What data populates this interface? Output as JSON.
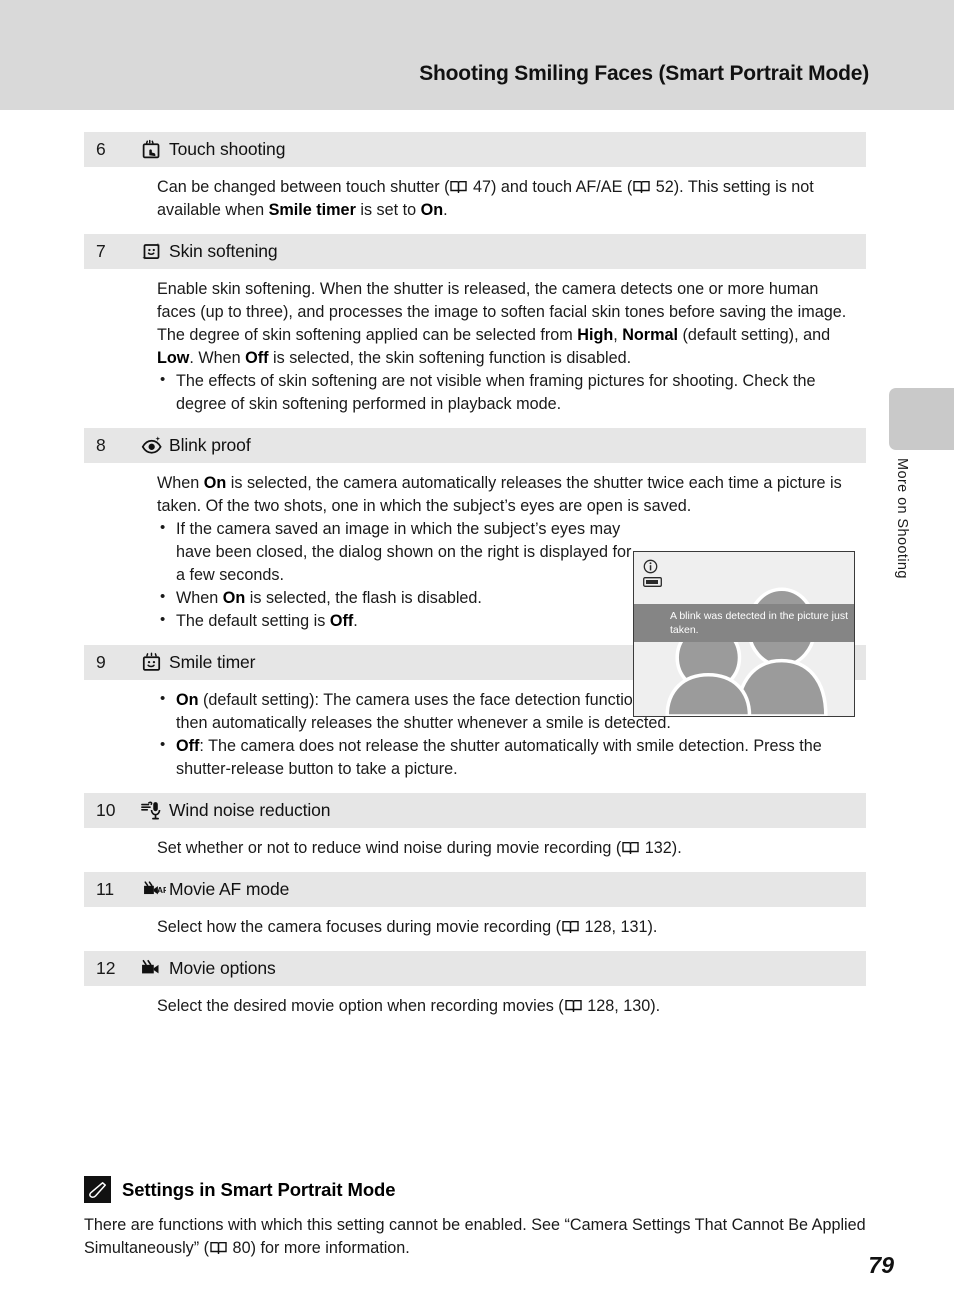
{
  "header": {
    "title": "Shooting Smiling Faces (Smart Portrait Mode)"
  },
  "side_tab": {
    "label": "More on Shooting"
  },
  "page_number": "79",
  "table": {
    "rows": [
      {
        "num": "6",
        "icon": "touch-shooting-icon",
        "title": "Touch shooting",
        "body_html": "Can be changed between touch shutter (<span class=\"book-ico\" data-name=\"manual-reference-icon\" data-interactable=\"false\"><svg width=\"17\" height=\"13\" viewBox=\"0 0 17 13\"><path d=\"M1 1.7h6.2c.6 0 1.1.5 1.3 1v8.6c-.3-.5-.7-.8-1.3-.8H1zM16 1.7H9.8c-.6 0-1.1.5-1.3 1v8.6c.3-.5.7-.8 1.3-.8H16z\" fill=\"none\" stroke=\"#111\" stroke-width=\"1.4\"/><path d=\"M8.5 2.6v8.8\" stroke=\"#111\" stroke-width=\"1.3\"/></svg></span> 47) and touch AF/AE (<span class=\"book-ico\" data-name=\"manual-reference-icon\" data-interactable=\"false\"><svg width=\"17\" height=\"13\" viewBox=\"0 0 17 13\"><path d=\"M1 1.7h6.2c.6 0 1.1.5 1.3 1v8.6c-.3-.5-.7-.8-1.3-.8H1zM16 1.7H9.8c-.6 0-1.1.5-1.3 1v8.6c.3-.5.7-.8 1.3-.8H16z\" fill=\"none\" stroke=\"#111\" stroke-width=\"1.4\"/><path d=\"M8.5 2.6v8.8\" stroke=\"#111\" stroke-width=\"1.3\"/></svg></span> 52). This setting is not available when <b>Smile timer</b> is set to <b>On</b>."
      },
      {
        "num": "7",
        "icon": "skin-softening-icon",
        "title": "Skin softening",
        "body_html": "Enable skin softening. When the shutter is released, the camera detects one or more human faces (up to three), and processes the image to soften facial skin tones before saving the image.<br>The degree of skin softening applied can be selected from <b>High</b>, <b>Normal</b> (default setting), and <b>Low</b>. When <b>Off</b> is selected, the skin softening function is disabled.<ul class=\"bullets\"><li data-name=\"list-item\" data-interactable=\"false\">The effects of skin softening are not visible when framing pictures for shooting. Check the degree of skin softening performed in playback mode.</li></ul>"
      },
      {
        "num": "8",
        "icon": "blink-proof-icon",
        "title": "Blink proof",
        "body_html": "When <b>On</b> is selected, the camera automatically releases the shutter twice each time a picture is taken. Of the two shots, one in which the subject&rsquo;s eyes are open is saved.<ul class=\"bullets\"><li data-name=\"list-item\" data-interactable=\"false\" style=\"max-width:460px\">If the camera saved an image in which the subject&rsquo;s eyes may have been closed, the dialog shown on the right is displayed for a few seconds.</li><li data-name=\"list-item\" data-interactable=\"false\">When <b>On</b> is selected, the flash is disabled.</li><li data-name=\"list-item\" data-interactable=\"false\">The default setting is <b>Off</b>.</li></ul>"
      },
      {
        "num": "9",
        "icon": "smile-timer-icon",
        "title": "Smile timer",
        "body_html": "<ul class=\"bullets\"><li data-name=\"list-item\" data-interactable=\"false\"><b>On</b> (default setting): The camera uses the face detection function to detect a human face, and then automatically releases the shutter whenever a smile is detected.</li><li data-name=\"list-item\" data-interactable=\"false\"><b>Off</b>: The camera does not release the shutter automatically with smile detection. Press the shutter-release button to take a picture.</li></ul>"
      },
      {
        "num": "10",
        "icon": "wind-noise-reduction-icon",
        "title": "Wind noise reduction",
        "body_html": "Set whether or not to reduce wind noise during movie recording (<span class=\"book-ico\" data-name=\"manual-reference-icon\" data-interactable=\"false\"><svg width=\"17\" height=\"13\" viewBox=\"0 0 17 13\"><path d=\"M1 1.7h6.2c.6 0 1.1.5 1.3 1v8.6c-.3-.5-.7-.8-1.3-.8H1zM16 1.7H9.8c-.6 0-1.1.5-1.3 1v8.6c.3-.5.7-.8 1.3-.8H16z\" fill=\"none\" stroke=\"#111\" stroke-width=\"1.4\"/><path d=\"M8.5 2.6v8.8\" stroke=\"#111\" stroke-width=\"1.3\"/></svg></span> 132)."
      },
      {
        "num": "11",
        "icon": "movie-af-mode-icon",
        "title": "Movie AF mode",
        "body_html": "Select how the camera focuses during movie recording (<span class=\"book-ico\" data-name=\"manual-reference-icon\" data-interactable=\"false\"><svg width=\"17\" height=\"13\" viewBox=\"0 0 17 13\"><path d=\"M1 1.7h6.2c.6 0 1.1.5 1.3 1v8.6c-.3-.5-.7-.8-1.3-.8H1zM16 1.7H9.8c-.6 0-1.1.5-1.3 1v8.6c.3-.5.7-.8 1.3-.8H16z\" fill=\"none\" stroke=\"#111\" stroke-width=\"1.4\"/><path d=\"M8.5 2.6v8.8\" stroke=\"#111\" stroke-width=\"1.3\"/></svg></span> 128, 131)."
      },
      {
        "num": "12",
        "icon": "movie-options-icon",
        "title": "Movie options",
        "body_html": "Select the desired movie option when recording movies (<span class=\"book-ico\" data-name=\"manual-reference-icon\" data-interactable=\"false\"><svg width=\"17\" height=\"13\" viewBox=\"0 0 17 13\"><path d=\"M1 1.7h6.2c.6 0 1.1.5 1.3 1v8.6c-.3-.5-.7-.8-1.3-.8H1zM16 1.7H9.8c-.6 0-1.1.5-1.3 1v8.6c.3-.5.7-.8 1.3-.8H16z\" fill=\"none\" stroke=\"#111\" stroke-width=\"1.4\"/><path d=\"M8.5 2.6v8.8\" stroke=\"#111\" stroke-width=\"1.3\"/></svg></span> 128, 130)."
      }
    ]
  },
  "camera_screen": {
    "message": "A blink was detected in the picture just taken.",
    "info_icon": "info-icon",
    "card_icon": "memory-card-icon",
    "banner_color": "#858585",
    "screen_bg": "#eeeeee",
    "silhouette_color": "#9b9b9b"
  },
  "note": {
    "badge_icon": "pencil-note-icon",
    "title": "Settings in Smart Portrait Mode",
    "body_html": "There are functions with which this setting cannot be enabled. See &ldquo;Camera Settings That Cannot Be Applied Simultaneously&rdquo; (<span class=\"book-ico\" data-name=\"manual-reference-icon\" data-interactable=\"false\"><svg width=\"17\" height=\"13\" viewBox=\"0 0 17 13\"><path d=\"M1 1.7h6.2c.6 0 1.1.5 1.3 1v8.6c-.3-.5-.7-.8-1.3-.8H1zM16 1.7H9.8c-.6 0-1.1.5-1.3 1v8.6c.3-.5.7-.8 1.3-.8H16z\" fill=\"none\" stroke=\"#111\" stroke-width=\"1.4\"/><path d=\"M8.5 2.6v8.8\" stroke=\"#111\" stroke-width=\"1.3\"/></svg></span> 80) for more information."
  },
  "colors": {
    "header_band": "#d9d9d9",
    "row_head": "#e6e6e6",
    "side_tab": "#c9c9c9"
  }
}
